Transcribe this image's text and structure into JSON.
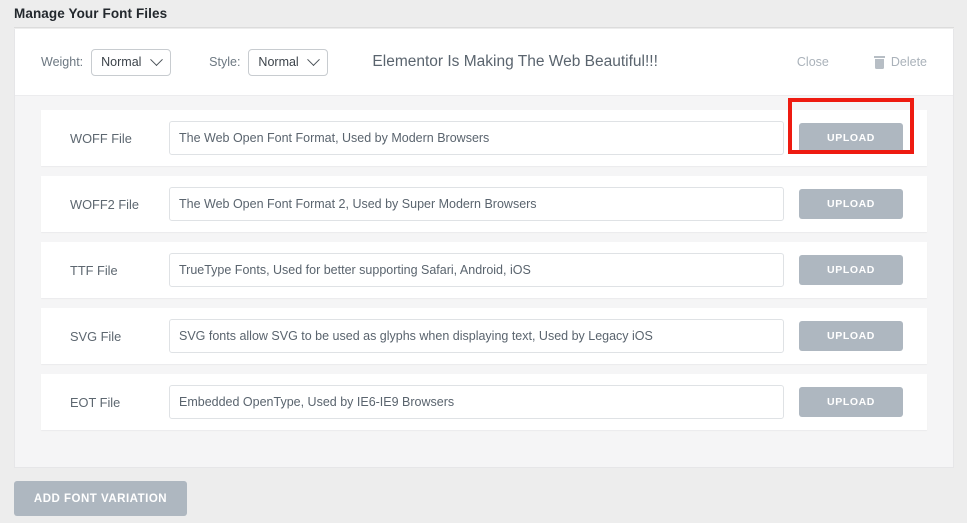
{
  "page": {
    "heading": "Manage Your Font Files"
  },
  "header": {
    "weight_label": "Weight:",
    "weight_value": "Normal",
    "style_label": "Style:",
    "style_value": "Normal",
    "preview_text": "Elementor Is Making The Web Beautiful!!!",
    "close_label": "Close",
    "delete_label": "Delete",
    "delete_icon": "trash-icon",
    "chevron_icon": "chevron-down-icon"
  },
  "rows": [
    {
      "label": "WOFF File",
      "value": "The Web Open Font Format, Used by Modern Browsers",
      "upload_label": "UPLOAD",
      "highlighted": true
    },
    {
      "label": "WOFF2 File",
      "value": "The Web Open Font Format 2, Used by Super Modern Browsers",
      "upload_label": "UPLOAD",
      "highlighted": false
    },
    {
      "label": "TTF File",
      "value": "TrueType Fonts, Used for better supporting Safari, Android, iOS",
      "upload_label": "UPLOAD",
      "highlighted": false
    },
    {
      "label": "SVG File",
      "value": "SVG fonts allow SVG to be used as glyphs when displaying text, Used by Legacy iOS",
      "upload_label": "UPLOAD",
      "highlighted": false
    },
    {
      "label": "EOT File",
      "value": "Embedded OpenType, Used by IE6-IE9 Browsers",
      "upload_label": "UPLOAD",
      "highlighted": false
    }
  ],
  "footer": {
    "add_variation_label": "ADD FONT VARIATION"
  },
  "colors": {
    "page_background": "#ededed",
    "panel_background": "#f5f5f6",
    "card_background": "#ffffff",
    "button_gray": "#aeb7c0",
    "highlight_red": "#ee1b11",
    "heading_text": "#23282d",
    "muted_text": "#aab2ba"
  }
}
